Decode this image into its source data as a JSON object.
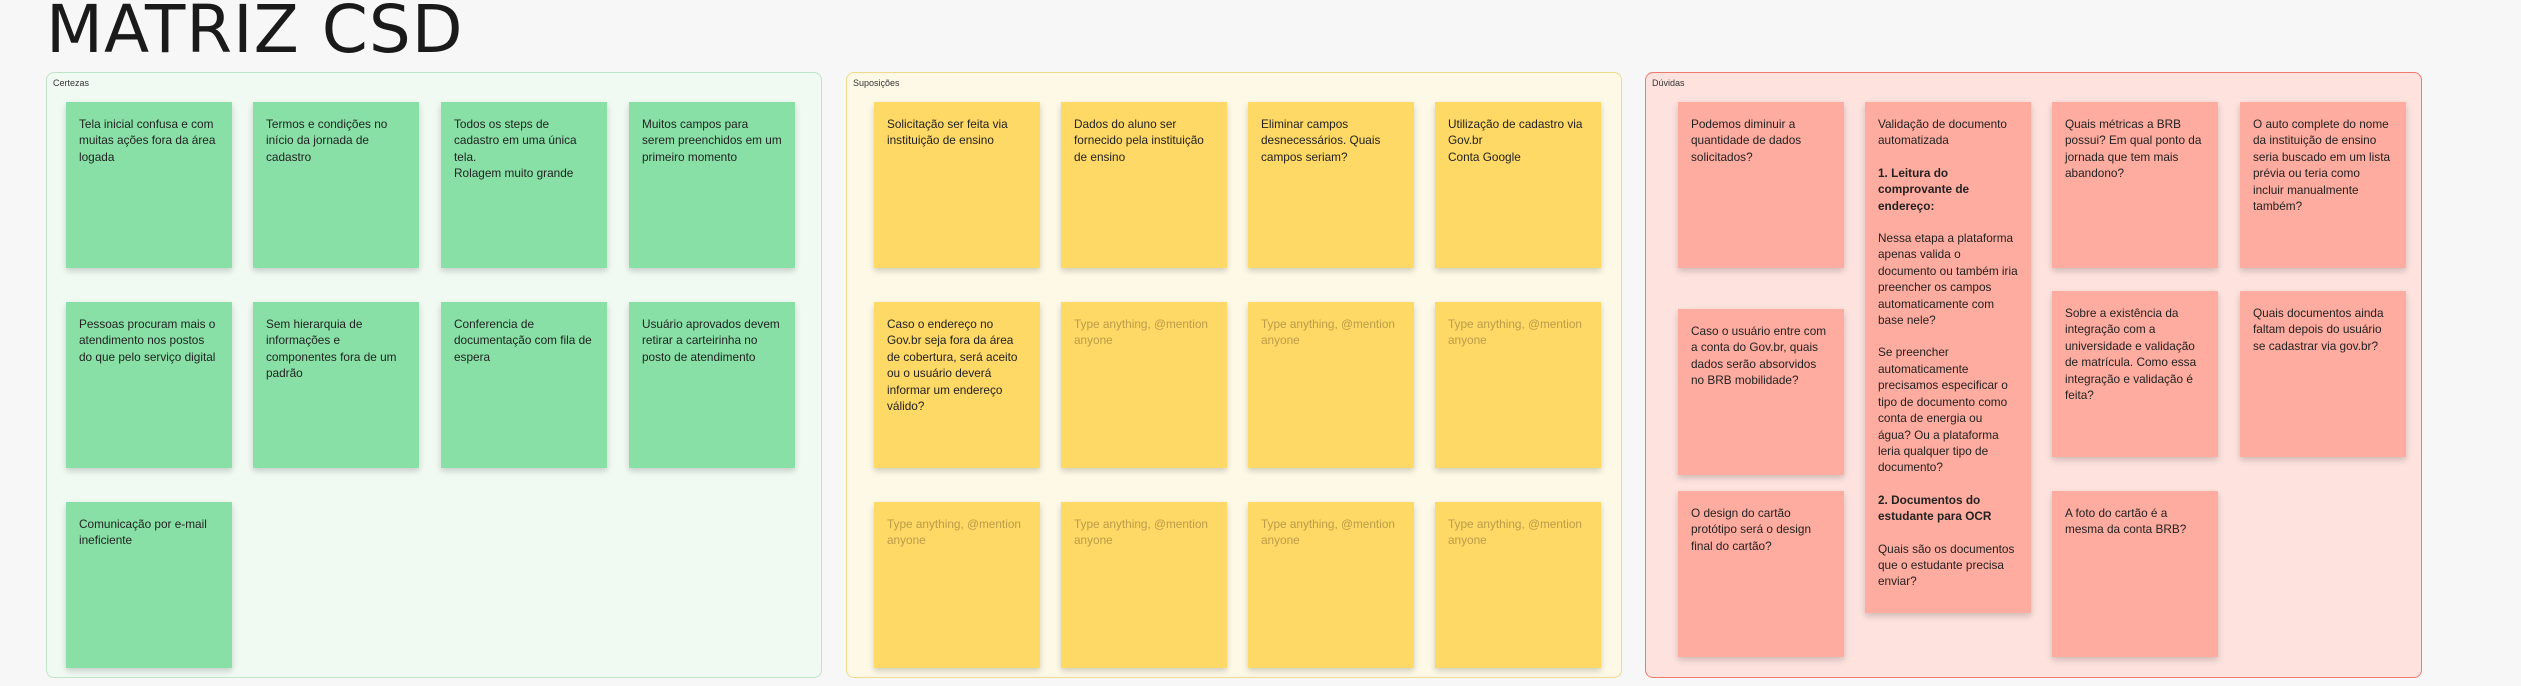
{
  "title": "MATRIZ CSD",
  "sections": {
    "certezas": {
      "label": "Certezas"
    },
    "suposicoes": {
      "label": "Suposições"
    },
    "duvidas": {
      "label": "Dúvidas"
    }
  },
  "certezas_notes": [
    "Tela inicial confusa e com muitas ações fora da área logada",
    "Termos e condições no início da jornada de cadastro",
    "Todos os steps de cadastro em uma única tela.\nRolagem muito grande",
    "Muitos campos para serem preenchidos em um primeiro momento",
    "Pessoas procuram mais o atendimento nos postos do que pelo serviço digital",
    "Sem hierarquia de informações e componentes fora de um padrão",
    "Conferencia de documentação com fila de espera",
    "Usuário aprovados devem retirar a carteirinha no posto de atendimento",
    "Comunicação por e-mail ineficiente"
  ],
  "suposicoes_notes": [
    "Solicitação ser feita via instituição de ensino",
    "Dados do aluno ser fornecido pela instituição de ensino",
    "Eliminar campos desnecessários. Quais campos seriam?",
    "Utilização de cadastro via Gov.br\nConta Google",
    "Caso o endereço no Gov.br seja fora da área de cobertura, será aceito ou o usuário deverá informar um endereço válido?"
  ],
  "placeholder": "Type anything, @mention anyone",
  "duvidas_notes": {
    "diminuir": "Podemos diminuir a quantidade de dados solicitados?",
    "gov_br": "Caso o usuário entre com a conta do Gov.br, quais dados serão absorvidos no BRB mobilidade?",
    "design": "O design do cartão protótipo será o design final do cartão?",
    "validacao": {
      "intro": "Validação de documento automatizada",
      "h1": "1. Leitura do comprovante de endereço:",
      "p1": "Nessa etapa a plataforma apenas valida o documento ou também iria preencher os campos automaticamente com base nele?",
      "p2": "Se preencher automaticamente precisamos especificar o tipo de documento como conta de energia ou água? Ou a plataforma leria qualquer tipo de documento?",
      "h2": "2. Documentos do estudante para OCR",
      "p3": "Quais são os documentos que o estudante precisa enviar?"
    },
    "metricas": "Quais métricas a BRB possui? Em qual ponto da jornada que tem mais abandono?",
    "integracao": "Sobre a existência da integração com a universidade e validação de matrícula. Como essa integração e validação é feita?",
    "foto": "A foto do cartão é a mesma da conta BRB?",
    "autocomplete": "O auto complete do nome da instituição de ensino seria buscado em um lista prévia ou teria como incluir manualmente também?",
    "documentos": "Quais documentos ainda faltam depois do usuário se cadastrar via gov.br?"
  }
}
